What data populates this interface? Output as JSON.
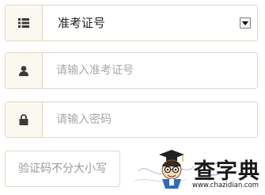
{
  "form": {
    "type_select": {
      "value": "准考证号",
      "icon": "list-icon"
    },
    "ticket_field": {
      "placeholder": "请输入准考证号",
      "icon": "user-icon"
    },
    "password_field": {
      "placeholder": "请输入密码",
      "icon": "lock-icon"
    },
    "captcha_field": {
      "placeholder": "验证码不分大小写"
    }
  },
  "watermark": {
    "brand_text": "查字典",
    "url_text": "www.chazidian.com"
  },
  "colors": {
    "border": "#e3d7bf",
    "icon_bg": "#fbf8f1",
    "icon": "#3a3a3a",
    "placeholder": "#a9a9a9"
  }
}
